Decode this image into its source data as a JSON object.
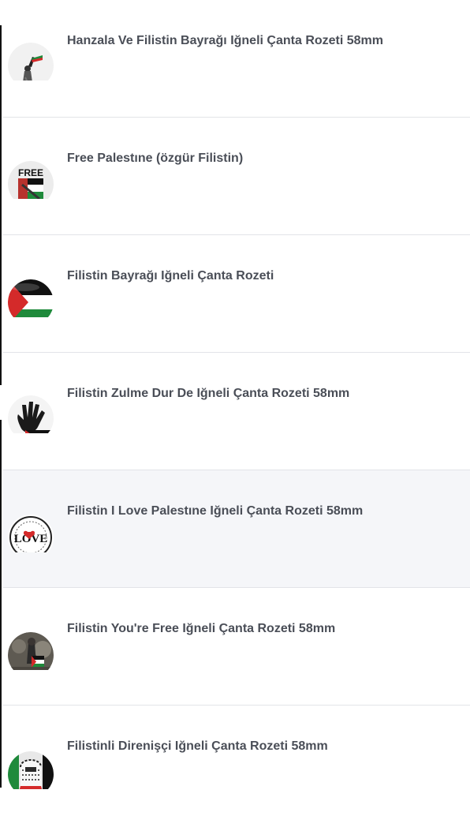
{
  "products": [
    {
      "title": "Hanzala Ve Filistin Bayrağı Iğneli Çanta Rozeti 58mm",
      "image": "badge-hanzala-flag"
    },
    {
      "title": "Free Palestıne (özgür Filistin)",
      "image": "badge-free-palestine",
      "image_text": "FREE"
    },
    {
      "title": "Filistin Bayrağı Iğneli Çanta Rozeti",
      "image": "badge-palestine-flag"
    },
    {
      "title": "Filistin Zulme Dur De Iğneli Çanta Rozeti 58mm",
      "image": "badge-hand-print"
    },
    {
      "title": "Filistin I Love Palestıne Iğneli Çanta Rozeti 58mm",
      "image": "badge-i-love-palestine",
      "image_text": "LOVE"
    },
    {
      "title": "Filistin You're Free Iğneli Çanta Rozeti 58mm",
      "image": "badge-youre-free"
    },
    {
      "title": "Filistinli Direnişçi Iğneli Çanta Rozeti 58mm",
      "image": "badge-resistance-fighter"
    }
  ],
  "colors": {
    "title_text": "#4a4e57",
    "divider": "#e2e4e8",
    "hover_row": "#f5f6f9",
    "flag_green": "#1f8a3b",
    "flag_red": "#d42a2a",
    "flag_black": "#111111"
  }
}
